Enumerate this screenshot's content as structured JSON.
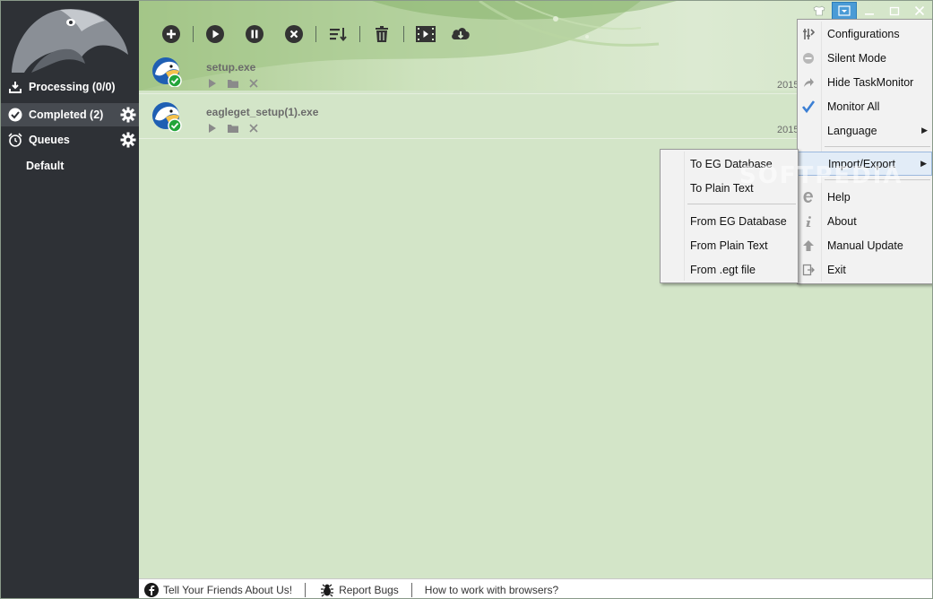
{
  "sidebar": {
    "items": [
      {
        "label": "Processing (0/0)",
        "icon": "download-icon"
      },
      {
        "label": "Completed (2)",
        "icon": "check-circle-icon"
      },
      {
        "label": "Queues",
        "icon": "alarm-clock-icon"
      }
    ],
    "sub_items": [
      {
        "label": "Default"
      }
    ]
  },
  "toolbar": {
    "buttons": [
      "add-icon",
      "play-icon",
      "pause-icon",
      "cancel-icon",
      "sort-icon",
      "trash-icon",
      "video-icon",
      "cloud-download-icon"
    ]
  },
  "downloads": [
    {
      "name": "setup.exe",
      "date": "2015"
    },
    {
      "name": "eagleget_setup(1).exe",
      "date": "2015"
    }
  ],
  "main_menu": {
    "items": [
      {
        "label": "Configurations",
        "icon": "tools-icon"
      },
      {
        "label": "Silent Mode",
        "icon": "minus-circle-icon"
      },
      {
        "label": "Hide TaskMonitor",
        "icon": "arrow-icon"
      },
      {
        "label": "Monitor All",
        "icon": "checkmark-icon"
      },
      {
        "label": "Language",
        "icon": ""
      },
      {
        "label": "Import/Export",
        "icon": ""
      },
      {
        "label": "Help",
        "icon": "help-e-icon"
      },
      {
        "label": "About",
        "icon": "info-icon"
      },
      {
        "label": "Manual Update",
        "icon": "up-arrow-icon"
      },
      {
        "label": "Exit",
        "icon": "exit-icon"
      }
    ]
  },
  "submenu": {
    "items": [
      {
        "label": "To EG Database"
      },
      {
        "label": "To Plain Text"
      },
      {
        "label": "From EG Database"
      },
      {
        "label": "From Plain Text"
      },
      {
        "label": "From .egt file"
      }
    ]
  },
  "statusbar": {
    "facebook": "Tell Your Friends About Us!",
    "bugs": "Report Bugs",
    "browsers": "How to work with browsers?"
  },
  "watermark": "SOFTPEDIA",
  "colors": {
    "sidebar": "#2e3136",
    "main": "#d3e5c8",
    "accent": "#4a9bd6",
    "check": "#22a53a"
  }
}
